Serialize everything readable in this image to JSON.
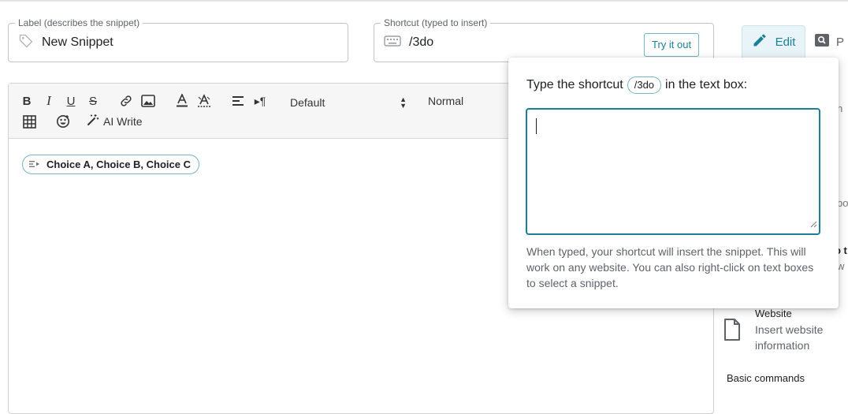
{
  "label_field": {
    "legend": "Label (describes the snippet)",
    "value": "New Snippet",
    "icon": "tag-icon"
  },
  "shortcut_field": {
    "legend": "Shortcut (typed to insert)",
    "value": "/3do",
    "icon": "keyboard-icon",
    "try_button": "Try it out"
  },
  "tabs": {
    "edit": "Edit",
    "preview_partial": "P"
  },
  "toolbar": {
    "font": "Default",
    "size": "Normal",
    "ai_write": "AI Write",
    "icons": [
      "bold-icon",
      "italic-icon",
      "underline-icon",
      "strikethrough-icon",
      "link-icon",
      "image-icon",
      "text-color-icon",
      "highlight-icon",
      "align-icon",
      "text-direction-icon",
      "table-icon",
      "emoji-icon",
      "magic-wand-icon"
    ]
  },
  "editor": {
    "chip": "Choice A, Choice B, Choice C"
  },
  "popup": {
    "prompt_before": "Type the shortcut",
    "shortcut": "/3do",
    "prompt_after": "in the text box:",
    "textarea_value": "",
    "help": "When typed, your shortcut will insert the snippet. This will work on any website. You can also right-click on text boxes to select a snippet."
  },
  "sidebar": {
    "partials": [
      "n",
      "bo",
      "o t",
      "w"
    ],
    "item": {
      "title": "Website",
      "desc": "Insert website information"
    },
    "section": "Basic commands"
  },
  "colors": {
    "accent": "#1a7f97",
    "accent_light": "#e8f4f8",
    "chip_border": "#74b5c4"
  }
}
